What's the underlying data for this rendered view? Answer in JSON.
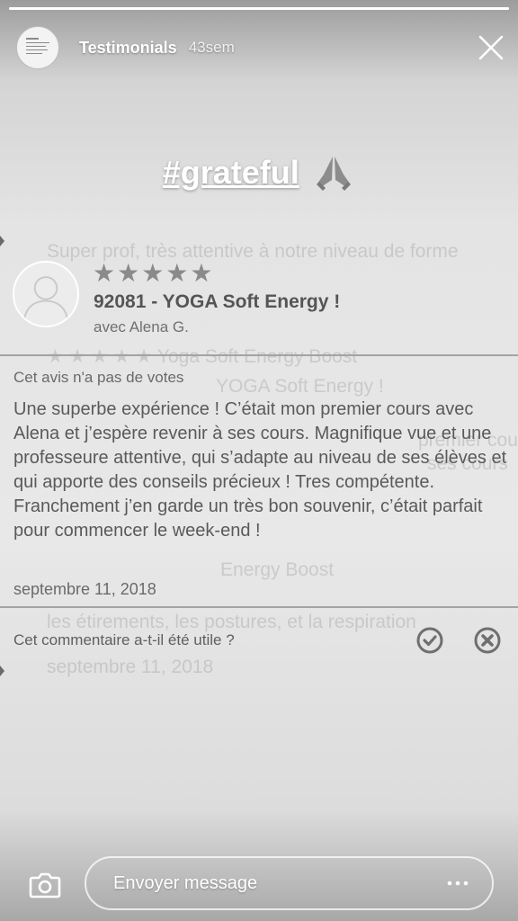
{
  "story": {
    "progress": 1.0,
    "title": "Testimonials",
    "time": "43sem",
    "hashtag": "#grateful"
  },
  "background_text": [
    "Super prof, très attentive à notre niveau de forme",
    "★ ★ ★ ★ ★  Yoga Soft Energy Boost",
    "YOGA Soft Energy !",
    "premier cours",
    "ses cours",
    "Energy Boost",
    "les étirements, les postures, et la respiration",
    "septembre 11, 2018"
  ],
  "review": {
    "stars": "★★★★★",
    "rating": 5,
    "title": "92081 - YOGA Soft Energy !",
    "subtitle": "avec Alena G.",
    "votes_text": "Cet avis n'a pas de votes",
    "body": "Une superbe expérience ! C’était mon premier cours avec Alena et j’espère revenir à ses cours. Magnifique vue et une professeure attentive, qui s’adapte au niveau de ses élèves et qui apporte des conseils précieux ! Tres compétente. Franchement j’en garde un très bon souvenir, c’était parfait pour commencer le week-end !",
    "date": "septembre 11, 2018",
    "helpful_question": "Cet commentaire a-t-il été utile ?"
  },
  "composer": {
    "placeholder": "Envoyer message"
  },
  "icons": {
    "close": "close-icon",
    "pray": "praying-hands-icon",
    "yes": "check-circle-icon",
    "no": "x-circle-icon",
    "camera": "camera-icon",
    "more": "more-dots-icon"
  }
}
